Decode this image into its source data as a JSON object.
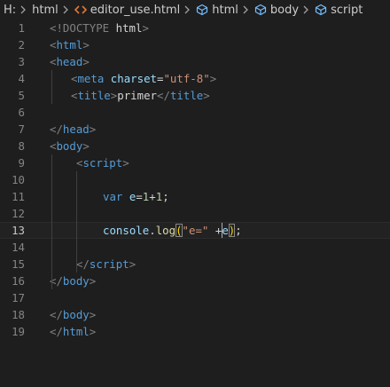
{
  "breadcrumb": {
    "drive": "H:",
    "folder": "html",
    "file": "editor_use.html",
    "symbols": [
      "html",
      "body",
      "script"
    ],
    "file_icon": "html-file-icon",
    "symbol_icon": "cube-symbol-icon",
    "separator_icon": "chevron-right-icon"
  },
  "editor": {
    "language": "html",
    "current_line": 13,
    "lines": [
      {
        "n": "1",
        "indent": 0,
        "tokens": [
          {
            "t": "<!DOCTYPE ",
            "c": "punc"
          },
          {
            "t": "html",
            "c": "txt"
          },
          {
            "t": ">",
            "c": "punc"
          }
        ]
      },
      {
        "n": "2",
        "indent": 0,
        "tokens": [
          {
            "t": "<",
            "c": "punc"
          },
          {
            "t": "html",
            "c": "tag"
          },
          {
            "t": ">",
            "c": "punc"
          }
        ]
      },
      {
        "n": "3",
        "indent": 0,
        "tokens": [
          {
            "t": "<",
            "c": "punc"
          },
          {
            "t": "head",
            "c": "tag"
          },
          {
            "t": ">",
            "c": "punc"
          }
        ]
      },
      {
        "n": "4",
        "indent": 1,
        "tokens": [
          {
            "t": "<",
            "c": "punc"
          },
          {
            "t": "meta",
            "c": "tag"
          },
          {
            "t": " ",
            "c": "txt"
          },
          {
            "t": "charset",
            "c": "attr"
          },
          {
            "t": "=",
            "c": "txt"
          },
          {
            "t": "\"utf-8\"",
            "c": "str"
          },
          {
            "t": ">",
            "c": "punc"
          }
        ]
      },
      {
        "n": "5",
        "indent": 1,
        "tokens": [
          {
            "t": "<",
            "c": "punc"
          },
          {
            "t": "title",
            "c": "tag"
          },
          {
            "t": ">",
            "c": "punc"
          },
          {
            "t": "primer",
            "c": "txt"
          },
          {
            "t": "</",
            "c": "punc"
          },
          {
            "t": "title",
            "c": "tag"
          },
          {
            "t": ">",
            "c": "punc"
          }
        ]
      },
      {
        "n": "6",
        "indent": 0,
        "tokens": []
      },
      {
        "n": "7",
        "indent": 0,
        "tokens": [
          {
            "t": "</",
            "c": "punc"
          },
          {
            "t": "head",
            "c": "tag"
          },
          {
            "t": ">",
            "c": "punc"
          }
        ]
      },
      {
        "n": "8",
        "indent": 0,
        "tokens": [
          {
            "t": "<",
            "c": "punc"
          },
          {
            "t": "body",
            "c": "tag"
          },
          {
            "t": ">",
            "c": "punc"
          }
        ]
      },
      {
        "n": "9",
        "indent": 1.25,
        "tokens": [
          {
            "t": "<",
            "c": "punc"
          },
          {
            "t": "script",
            "c": "tag"
          },
          {
            "t": ">",
            "c": "punc"
          }
        ]
      },
      {
        "n": "10",
        "indent": 0,
        "tokens": []
      },
      {
        "n": "11",
        "indent": 2.5,
        "tokens": [
          {
            "t": "var",
            "c": "kw"
          },
          {
            "t": " ",
            "c": "txt"
          },
          {
            "t": "e",
            "c": "ident"
          },
          {
            "t": "=",
            "c": "txt"
          },
          {
            "t": "1",
            "c": "num"
          },
          {
            "t": "+",
            "c": "txt"
          },
          {
            "t": "1",
            "c": "num"
          },
          {
            "t": ";",
            "c": "txt"
          }
        ]
      },
      {
        "n": "12",
        "indent": 0,
        "tokens": []
      },
      {
        "n": "13",
        "indent": 2.5,
        "tokens": [
          {
            "t": "console",
            "c": "ident"
          },
          {
            "t": ".",
            "c": "txt"
          },
          {
            "t": "log",
            "c": "fn"
          },
          {
            "t": "(",
            "c": "brk"
          },
          {
            "t": "\"e=\"",
            "c": "str"
          },
          {
            "t": " +",
            "c": "txt"
          },
          {
            "t": "e",
            "c": "ident"
          },
          {
            "t": ")",
            "c": "brk"
          },
          {
            "t": ";",
            "c": "txt"
          }
        ]
      },
      {
        "n": "14",
        "indent": 0,
        "tokens": []
      },
      {
        "n": "15",
        "indent": 1.25,
        "tokens": [
          {
            "t": "</",
            "c": "punc"
          },
          {
            "t": "script",
            "c": "tag"
          },
          {
            "t": ">",
            "c": "punc"
          }
        ]
      },
      {
        "n": "16",
        "indent": 0,
        "tokens": [
          {
            "t": "</",
            "c": "punc"
          },
          {
            "t": "body",
            "c": "tag"
          },
          {
            "t": ">",
            "c": "punc"
          }
        ]
      },
      {
        "n": "17",
        "indent": 0,
        "tokens": []
      },
      {
        "n": "18",
        "indent": 0,
        "tokens": [
          {
            "t": "</",
            "c": "punc"
          },
          {
            "t": "body",
            "c": "tag"
          },
          {
            "t": ">",
            "c": "punc"
          }
        ]
      },
      {
        "n": "19",
        "indent": 0,
        "tokens": [
          {
            "t": "</",
            "c": "punc"
          },
          {
            "t": "html",
            "c": "tag"
          },
          {
            "t": ">",
            "c": "punc"
          }
        ]
      }
    ]
  }
}
